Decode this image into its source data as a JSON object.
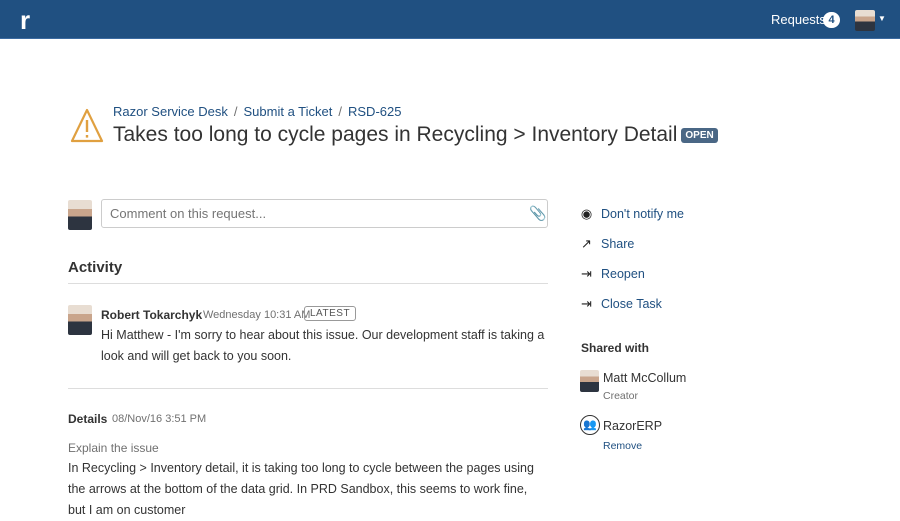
{
  "header": {
    "logo": "r",
    "requests_label": "Requests",
    "requests_count": "4"
  },
  "breadcrumb": [
    "Razor Service Desk",
    "Submit a Ticket",
    "RSD-625"
  ],
  "ticket": {
    "title": "Takes too long to cycle pages in Recycling > Inventory Detail",
    "status": "OPEN"
  },
  "comment": {
    "placeholder": "Comment on this request..."
  },
  "activity": {
    "heading": "Activity",
    "entries": [
      {
        "author": "Robert Tokarchyk",
        "time": "Wednesday 10:31 AM",
        "badge": "LATEST",
        "text": "Hi Matthew - I'm sorry to hear about this issue. Our development staff is taking a look and will get back to you soon."
      }
    ]
  },
  "details": {
    "label": "Details",
    "time": "08/Nov/16 3:51 PM",
    "field": "Explain the issue",
    "text": "In Recycling > Inventory detail, it is taking too long to cycle between the pages using the arrows at the bottom of the data grid.  In PRD Sandbox, this seems to work fine, but I am on customer"
  },
  "actions": [
    "Don't notify me",
    "Share",
    "Reopen",
    "Close Task"
  ],
  "shared": {
    "heading": "Shared with",
    "people": [
      {
        "name": "Matt McCollum",
        "role": "Creator"
      },
      {
        "name": "RazorERP",
        "action": "Remove"
      }
    ]
  }
}
